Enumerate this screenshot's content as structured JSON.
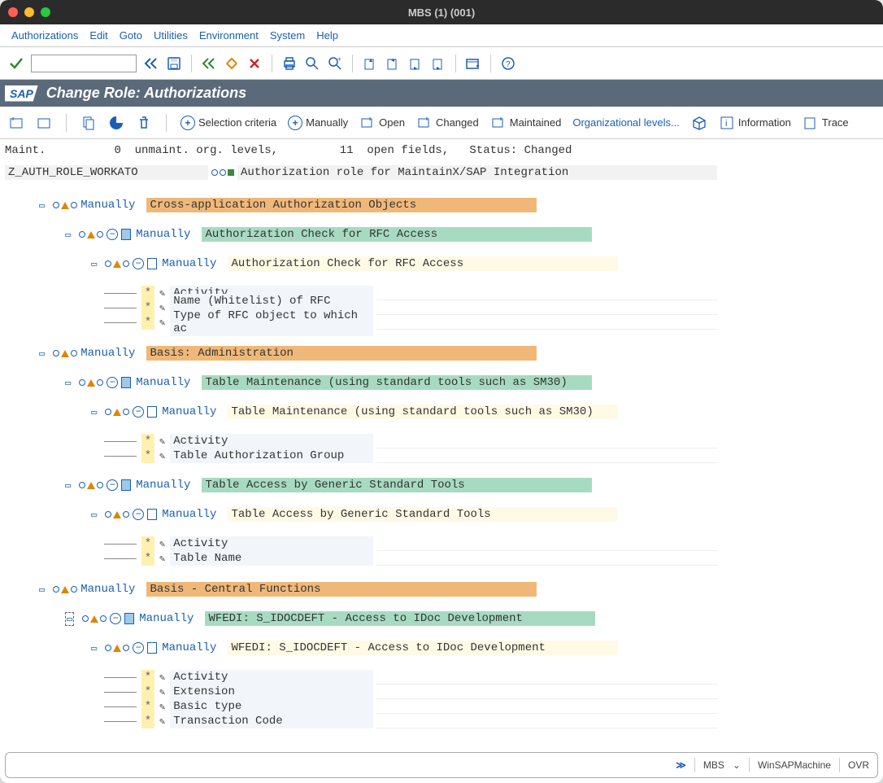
{
  "window": {
    "title": "MBS (1) (001)"
  },
  "menu": {
    "items": [
      "Authorizations",
      "Edit",
      "Goto",
      "Utilities",
      "Environment",
      "System",
      "Help"
    ]
  },
  "banner": {
    "title": "Change Role: Authorizations"
  },
  "toolbar2": {
    "selection": "Selection criteria",
    "manually": "Manually",
    "open": "Open",
    "changed": "Changed",
    "maintained": "Maintained",
    "orglevels": "Organizational levels...",
    "information": "Information",
    "trace": "Trace"
  },
  "status": {
    "maint_label": "Maint.",
    "maint_val": "0",
    "unmaint": "unmaint. org. levels,",
    "open_count": "11",
    "open_label": "open fields,",
    "status_label": "Status:",
    "status_val": "Changed"
  },
  "role": {
    "name": "Z_AUTH_ROLE_WORKATO",
    "desc": "Authorization role for MaintainX/SAP Integration"
  },
  "tree": {
    "manually": "Manually",
    "n1": {
      "label": "Cross-application Authorization Objects",
      "c1": {
        "label": "Authorization Check for RFC Access",
        "g1": {
          "label": "Authorization Check for RFC Access",
          "f": [
            "Activity",
            "Name (Whitelist) of RFC object",
            "Type of RFC object to which ac"
          ]
        }
      }
    },
    "n2": {
      "label": "Basis: Administration",
      "c1": {
        "label": "Table Maintenance (using standard tools such as SM30)",
        "g1": {
          "label": "Table Maintenance (using standard tools such as SM30)",
          "f": [
            "Activity",
            "Table Authorization Group"
          ]
        }
      },
      "c2": {
        "label": "Table Access by Generic Standard Tools",
        "g1": {
          "label": "Table Access by Generic Standard Tools",
          "f": [
            "Activity",
            "Table Name"
          ]
        }
      }
    },
    "n3": {
      "label": "Basis - Central Functions",
      "c1": {
        "label": "WFEDI: S_IDOCDEFT - Access to IDoc Development",
        "g1": {
          "label": "WFEDI: S_IDOCDEFT - Access to IDoc Development",
          "f": [
            "Activity",
            "Extension",
            "Basic type",
            "Transaction Code"
          ]
        }
      }
    }
  },
  "bottom": {
    "sys": "MBS",
    "host": "WinSAPMachine",
    "mode": "OVR"
  }
}
